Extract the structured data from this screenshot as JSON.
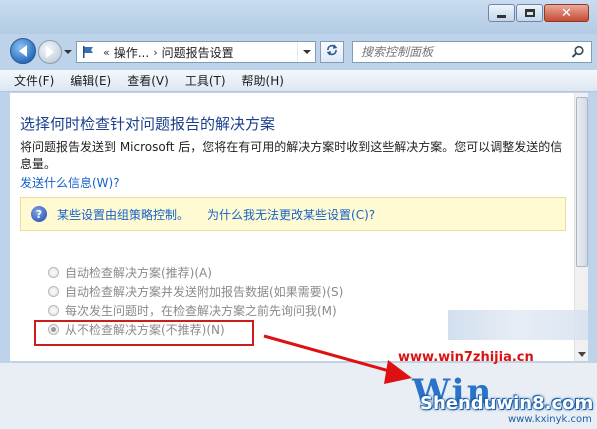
{
  "window": {
    "controls": {
      "minimize_icon": "minimize-icon",
      "maximize_icon": "maximize-icon",
      "close_glyph": "✕"
    }
  },
  "address_bar": {
    "crumbs": [
      "操作...",
      "问题报告设置"
    ],
    "crumb_separator": "›",
    "overflow_marker": "«"
  },
  "search": {
    "placeholder": "搜索控制面板"
  },
  "menu": {
    "items": [
      "文件(F)",
      "编辑(E)",
      "查看(V)",
      "工具(T)",
      "帮助(H)"
    ]
  },
  "content": {
    "heading": "选择何时检查针对问题报告的解决方案",
    "description": "将问题报告发送到 Microsoft 后，您将在有可用的解决方案时收到这些解决方案。您可以调整发送的信息量。",
    "info_link": "发送什么信息(W)?",
    "notice": {
      "text": "某些设置由组策略控制。",
      "link": "为什么我无法更改某些设置(C)?"
    },
    "options": [
      {
        "label": "自动检查解决方案(推荐)(A)",
        "selected": false
      },
      {
        "label": "自动检查解决方案并发送附加报告数据(如果需要)(S)",
        "selected": false
      },
      {
        "label": "每次发生问题时，在检查解决方案之前先询问我(M)",
        "selected": false
      },
      {
        "label": "从不检查解决方案(不推荐)(N)",
        "selected": true
      }
    ]
  },
  "watermark": {
    "url": "www.win7zhijia.cn",
    "logo": "Win",
    "brand": "Shenduwin8.com",
    "site": "www.kxinyk.com"
  },
  "colors": {
    "heading": "#1b3f8c",
    "link": "#1561c8",
    "notice_bg": "#fffad2",
    "highlight_box": "#c91e1e"
  }
}
